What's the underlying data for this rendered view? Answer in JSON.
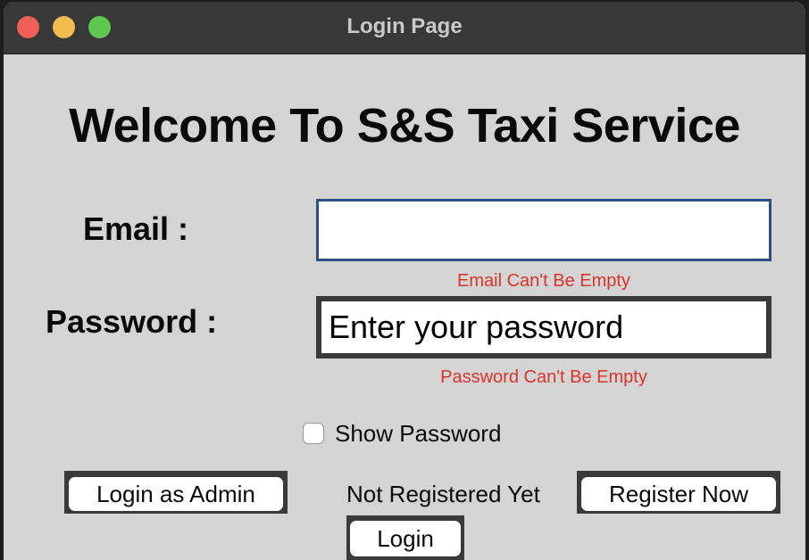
{
  "window": {
    "title": "Login Page",
    "controls": [
      "close-button",
      "minimize-button",
      "maximize-button"
    ]
  },
  "main": {
    "heading": "Welcome To S&S Taxi Service",
    "email": {
      "label": "Email :",
      "value": "",
      "placeholder": "",
      "error": "Email Can't Be Empty"
    },
    "password": {
      "label": "Password :",
      "value": "",
      "placeholder": "Enter your password",
      "error": "Password Can't Be Empty"
    },
    "show_password": {
      "label": "Show Password",
      "checked": false
    },
    "buttons": {
      "admin_login": "Login as Admin",
      "register": "Register Now",
      "login": "Login"
    },
    "not_registered_text": "Not Registered Yet"
  },
  "colors": {
    "error": "#d9342b",
    "focus_border": "#2e5080",
    "titlebar": "#383838",
    "window_bg": "#d4d4d4"
  }
}
